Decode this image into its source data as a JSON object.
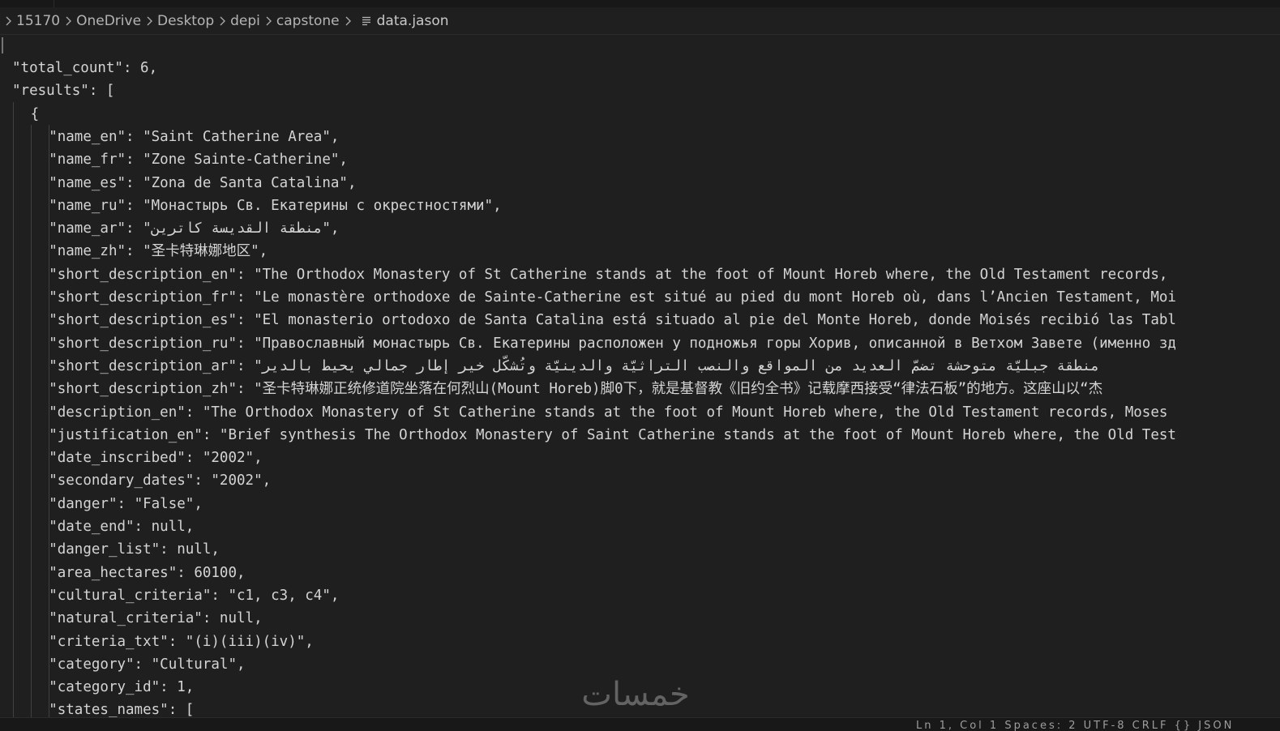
{
  "breadcrumb": {
    "items": [
      "15170",
      "OneDrive",
      "Desktop",
      "depi",
      "capstone"
    ],
    "file": "data.jason",
    "file_icon": "text-lines-icon",
    "separator_icon": "chevron-right-icon"
  },
  "code": {
    "lines": [
      {
        "key": "\"total_count\"",
        "sep": ": ",
        "value": "6",
        "tail": ",",
        "vtype": "num"
      },
      {
        "key": "\"results\"",
        "sep": ": ",
        "value": "[",
        "tail": "",
        "vtype": "punc"
      },
      {
        "key": "",
        "sep": "",
        "value": "{",
        "tail": "",
        "vtype": "punc"
      },
      {
        "key": "\"name_en\"",
        "sep": ": ",
        "value": "\"Saint Catherine Area\"",
        "tail": ",",
        "vtype": "str"
      },
      {
        "key": "\"name_fr\"",
        "sep": ": ",
        "value": "\"Zone Sainte-Catherine\"",
        "tail": ",",
        "vtype": "str"
      },
      {
        "key": "\"name_es\"",
        "sep": ": ",
        "value": "\"Zona de Santa Catalina\"",
        "tail": ",",
        "vtype": "str"
      },
      {
        "key": "\"name_ru\"",
        "sep": ": ",
        "value": "\"Монастырь Св. Екатерины с окрестностями\"",
        "tail": ",",
        "vtype": "str"
      },
      {
        "key": "\"name_ar\"",
        "sep": ": ",
        "value": "\"منطقة القديسة كاترين\"",
        "tail": ",",
        "vtype": "str"
      },
      {
        "key": "\"name_zh\"",
        "sep": ": ",
        "value": "\"圣卡特琳娜地区\"",
        "tail": ",",
        "vtype": "str"
      },
      {
        "key": "\"short_description_en\"",
        "sep": ": ",
        "value": "\"The Orthodox Monastery of St Catherine stands at the foot of Mount Horeb where, the Old Testament records,",
        "tail": "",
        "vtype": "str"
      },
      {
        "key": "\"short_description_fr\"",
        "sep": ": ",
        "value": "\"Le monastère orthodoxe de Sainte-Catherine est situé au pied du mont Horeb où, dans l’Ancien Testament, Moi",
        "tail": "",
        "vtype": "str"
      },
      {
        "key": "\"short_description_es\"",
        "sep": ": ",
        "value": "\"El monasterio ortodoxo de Santa Catalina está situado al pie del Monte Horeb, donde Moisés recibió las Tabl",
        "tail": "",
        "vtype": "str"
      },
      {
        "key": "\"short_description_ru\"",
        "sep": ": ",
        "value": "\"Православный монастырь Св. Екатерины расположен у подножья горы Хорив, описанной в Ветхом Завете (именно зд",
        "tail": "",
        "vtype": "str"
      },
      {
        "key": "\"short_description_ar\"",
        "sep": ": ",
        "value": "\"منطقة جبليّة متوحشة تضمّ العديد من المواقع والنصب التراثيّة والدينيّة وتُشكّل خير إطار جمالي يحيط بالدير",
        "tail": "",
        "vtype": "str"
      },
      {
        "key": "\"short_description_zh\"",
        "sep": ": ",
        "value": "\"圣卡特琳娜正统修道院坐落在何烈山(Mount Horeb)脚0下，就是基督教《旧约全书》记载摩西接受“律法石板”的地方。这座山以“杰",
        "tail": "",
        "vtype": "str"
      },
      {
        "key": "\"description_en\"",
        "sep": ": ",
        "value": "\"The Orthodox Monastery of St Catherine stands at the foot of Mount Horeb where, the Old Testament records, Moses",
        "tail": "",
        "vtype": "str"
      },
      {
        "key": "\"justification_en\"",
        "sep": ": ",
        "value": "\"Brief synthesis The Orthodox Monastery of Saint Catherine stands at the foot of Mount Horeb where, the Old Test",
        "tail": "",
        "vtype": "str"
      },
      {
        "key": "\"date_inscribed\"",
        "sep": ": ",
        "value": "\"2002\"",
        "tail": ",",
        "vtype": "str"
      },
      {
        "key": "\"secondary_dates\"",
        "sep": ": ",
        "value": "\"2002\"",
        "tail": ",",
        "vtype": "str"
      },
      {
        "key": "\"danger\"",
        "sep": ": ",
        "value": "\"False\"",
        "tail": ",",
        "vtype": "str"
      },
      {
        "key": "\"date_end\"",
        "sep": ": ",
        "value": "null",
        "tail": ",",
        "vtype": "lit"
      },
      {
        "key": "\"danger_list\"",
        "sep": ": ",
        "value": "null",
        "tail": ",",
        "vtype": "lit"
      },
      {
        "key": "\"area_hectares\"",
        "sep": ": ",
        "value": "60100",
        "tail": ",",
        "vtype": "num"
      },
      {
        "key": "\"cultural_criteria\"",
        "sep": ": ",
        "value": "\"c1, c3, c4\"",
        "tail": ",",
        "vtype": "str"
      },
      {
        "key": "\"natural_criteria\"",
        "sep": ": ",
        "value": "null",
        "tail": ",",
        "vtype": "lit"
      },
      {
        "key": "\"criteria_txt\"",
        "sep": ": ",
        "value": "\"(i)(iii)(iv)\"",
        "tail": ",",
        "vtype": "str"
      },
      {
        "key": "\"category\"",
        "sep": ": ",
        "value": "\"Cultural\"",
        "tail": ",",
        "vtype": "str"
      },
      {
        "key": "\"category_id\"",
        "sep": ": ",
        "value": "1",
        "tail": ",",
        "vtype": "num"
      },
      {
        "key": "\"states_names\"",
        "sep": ": ",
        "value": "[",
        "tail": "",
        "vtype": "punc"
      }
    ]
  },
  "status_bar": {
    "partial_text": "Ln 1, Col 1   Spaces: 2   UTF-8   CRLF   {} JSON"
  },
  "watermark": {
    "text": "خمسات",
    "color": "#6b6b6b"
  }
}
